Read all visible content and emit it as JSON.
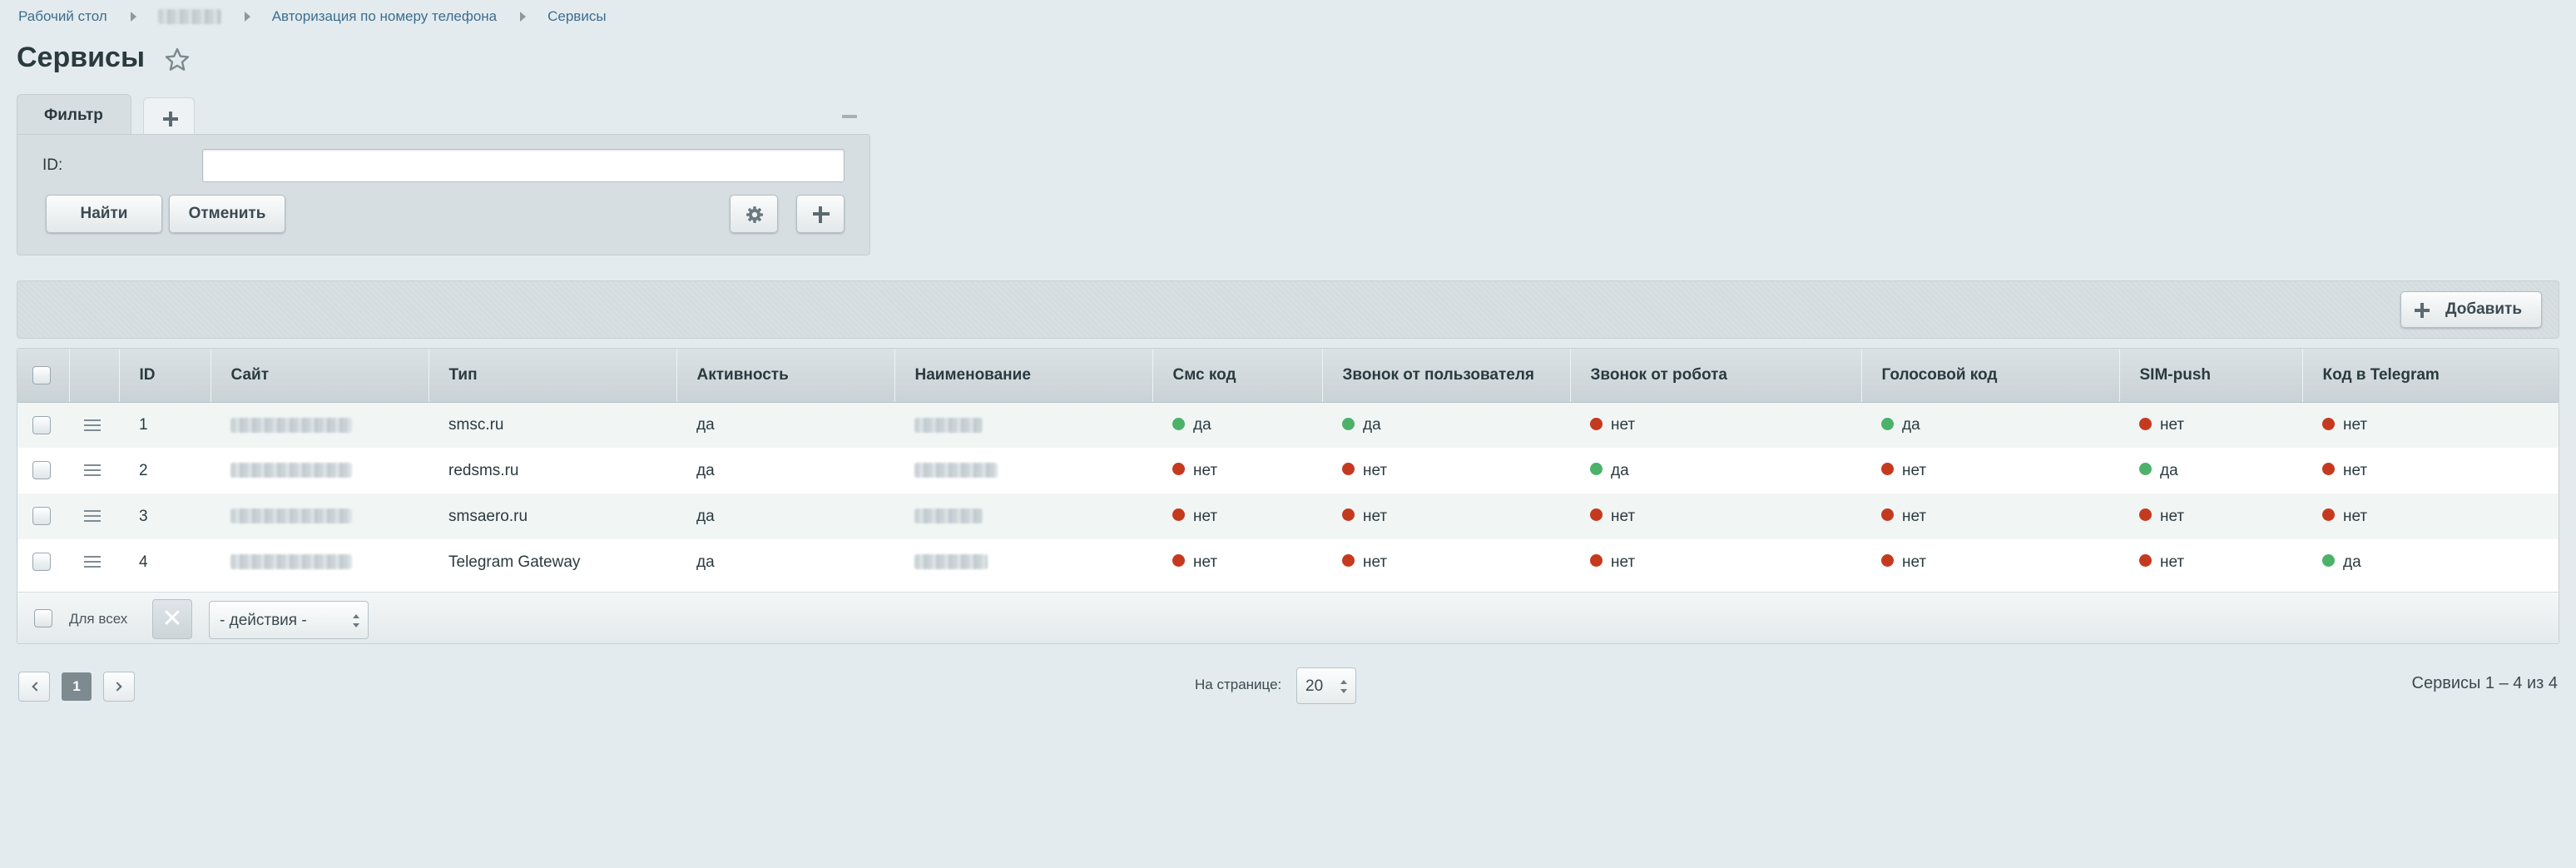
{
  "breadcrumb": [
    "Рабочий стол",
    "",
    "Авторизация по номеру телефона",
    "Сервисы"
  ],
  "page_title": "Сервисы",
  "filter": {
    "tab_label": "Фильтр",
    "id_label": "ID:",
    "id_value": "",
    "find_label": "Найти",
    "cancel_label": "Отменить"
  },
  "toolbar": {
    "add_label": "Добавить"
  },
  "table": {
    "columns": [
      "ID",
      "Сайт",
      "Тип",
      "Активность",
      "Наименование",
      "Смс код",
      "Звонок от пользователя",
      "Звонок от робота",
      "Голосовой код",
      "SIM-push",
      "Код в Telegram"
    ],
    "rows": [
      {
        "id": "1",
        "type": "smsc.ru",
        "active": "да",
        "sms": "да",
        "user_call": "да",
        "robot_call": "нет",
        "voice": "да",
        "sim_push": "нет",
        "telegram": "нет"
      },
      {
        "id": "2",
        "type": "redsms.ru",
        "active": "да",
        "sms": "нет",
        "user_call": "нет",
        "robot_call": "да",
        "voice": "нет",
        "sim_push": "да",
        "telegram": "нет"
      },
      {
        "id": "3",
        "type": "smsaero.ru",
        "active": "да",
        "sms": "нет",
        "user_call": "нет",
        "robot_call": "нет",
        "voice": "нет",
        "sim_push": "нет",
        "telegram": "нет"
      },
      {
        "id": "4",
        "type": "Telegram Gateway",
        "active": "да",
        "sms": "нет",
        "user_call": "нет",
        "robot_call": "нет",
        "voice": "нет",
        "sim_push": "нет",
        "telegram": "да"
      }
    ],
    "footer": {
      "for_all_label": "Для всех",
      "delete_glyph": "✕",
      "actions_label": "- действия -"
    }
  },
  "pagination": {
    "current_page": "1",
    "per_page_label": "На странице:",
    "per_page_value": "20",
    "range_info": "Сервисы 1 – 4 из 4"
  },
  "colors": {
    "yes": "#4cb26a",
    "no": "#c53a1f",
    "background": "#e3ebee"
  },
  "icons": [
    "star-icon",
    "plus-icon",
    "minimize-icon",
    "gear-icon",
    "menu-icon",
    "close-icon",
    "chevron-left-icon",
    "chevron-right-icon"
  ]
}
